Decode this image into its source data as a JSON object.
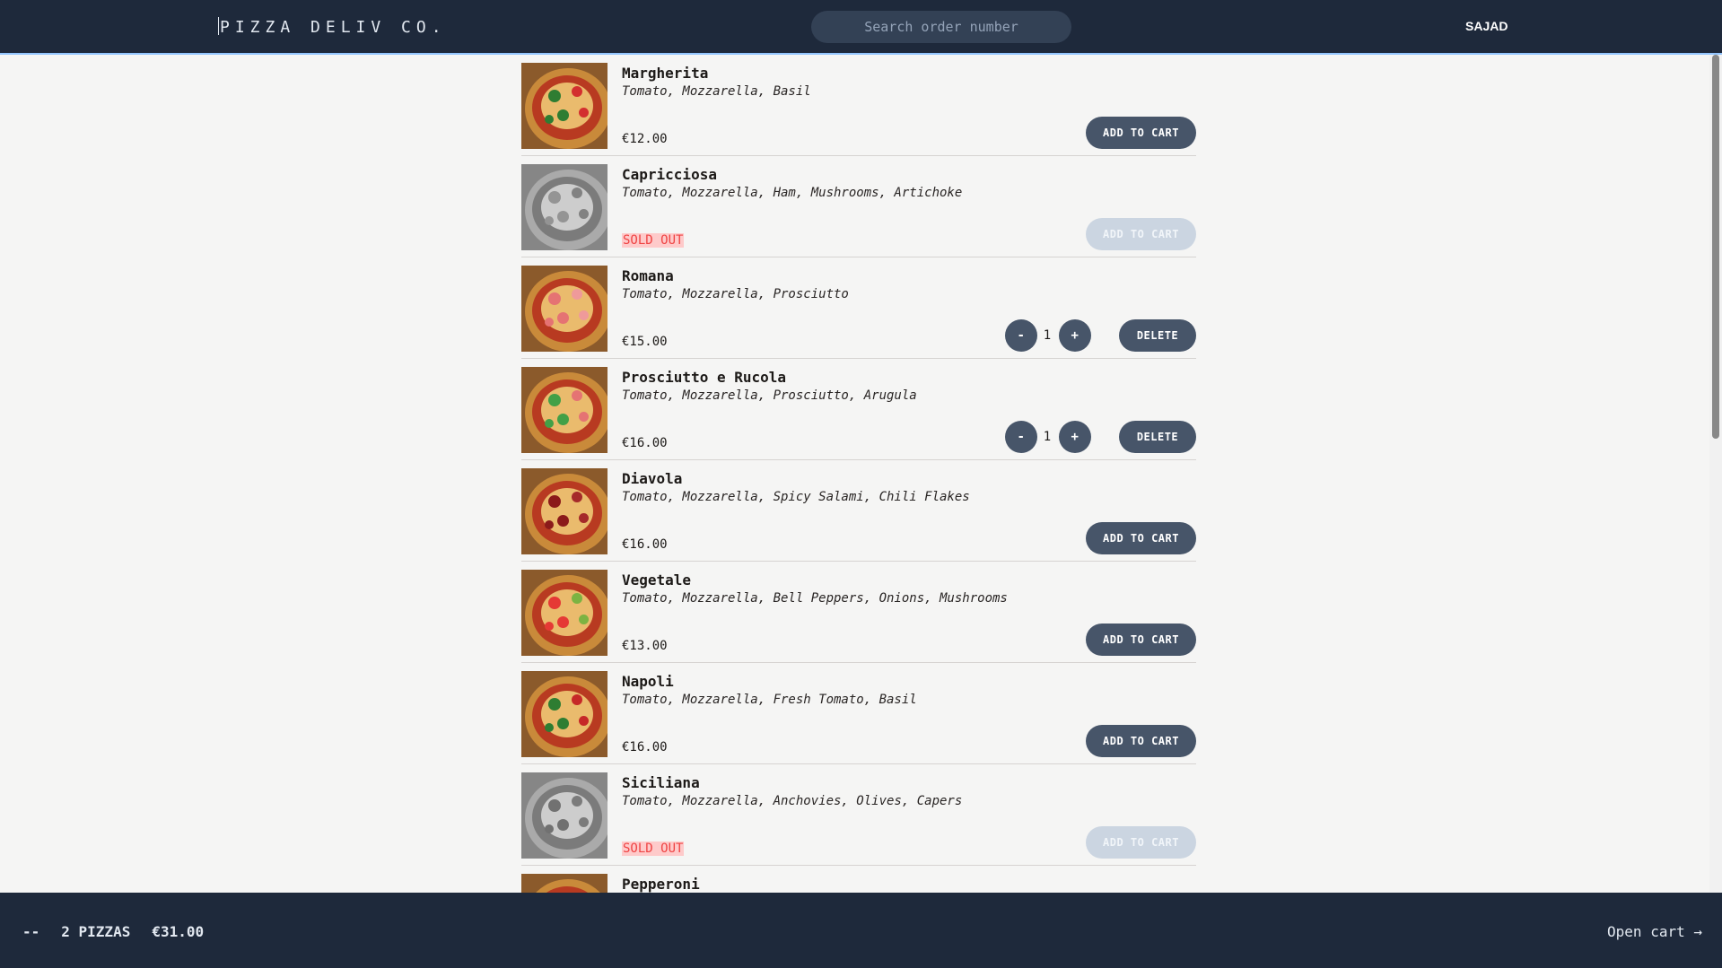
{
  "header": {
    "logo": "PIZZA DELIV CO.",
    "search_placeholder": "Search order number",
    "username": "SAJAD"
  },
  "menu": {
    "add_label": "ADD TO CART",
    "delete_label": "DELETE",
    "sold_out_label": "SOLD OUT",
    "minus_label": "-",
    "plus_label": "+",
    "items": [
      {
        "name": "Margherita",
        "ingredients": "Tomato, Mozzarella, Basil",
        "price": "€12.00",
        "sold_out": false,
        "quantity": 0
      },
      {
        "name": "Capricciosa",
        "ingredients": "Tomato, Mozzarella, Ham, Mushrooms, Artichoke",
        "price": "",
        "sold_out": true,
        "quantity": 0
      },
      {
        "name": "Romana",
        "ingredients": "Tomato, Mozzarella, Prosciutto",
        "price": "€15.00",
        "sold_out": false,
        "quantity": 1
      },
      {
        "name": "Prosciutto e Rucola",
        "ingredients": "Tomato, Mozzarella, Prosciutto, Arugula",
        "price": "€16.00",
        "sold_out": false,
        "quantity": 1
      },
      {
        "name": "Diavola",
        "ingredients": "Tomato, Mozzarella, Spicy Salami, Chili Flakes",
        "price": "€16.00",
        "sold_out": false,
        "quantity": 0
      },
      {
        "name": "Vegetale",
        "ingredients": "Tomato, Mozzarella, Bell Peppers, Onions, Mushrooms",
        "price": "€13.00",
        "sold_out": false,
        "quantity": 0
      },
      {
        "name": "Napoli",
        "ingredients": "Tomato, Mozzarella, Fresh Tomato, Basil",
        "price": "€16.00",
        "sold_out": false,
        "quantity": 0
      },
      {
        "name": "Siciliana",
        "ingredients": "Tomato, Mozzarella, Anchovies, Olives, Capers",
        "price": "",
        "sold_out": true,
        "quantity": 0
      },
      {
        "name": "Pepperoni",
        "ingredients": "",
        "price": "",
        "sold_out": false,
        "quantity": 0
      }
    ]
  },
  "footer": {
    "prefix": "--",
    "pizza_count": "2 PIZZAS",
    "total": "€31.00",
    "open_cart": "Open cart →"
  },
  "colors": {
    "header_bg": "#1e293b",
    "button_bg": "#475569",
    "sold_out_text": "#ef4444",
    "sold_out_bg": "#fecaca"
  }
}
